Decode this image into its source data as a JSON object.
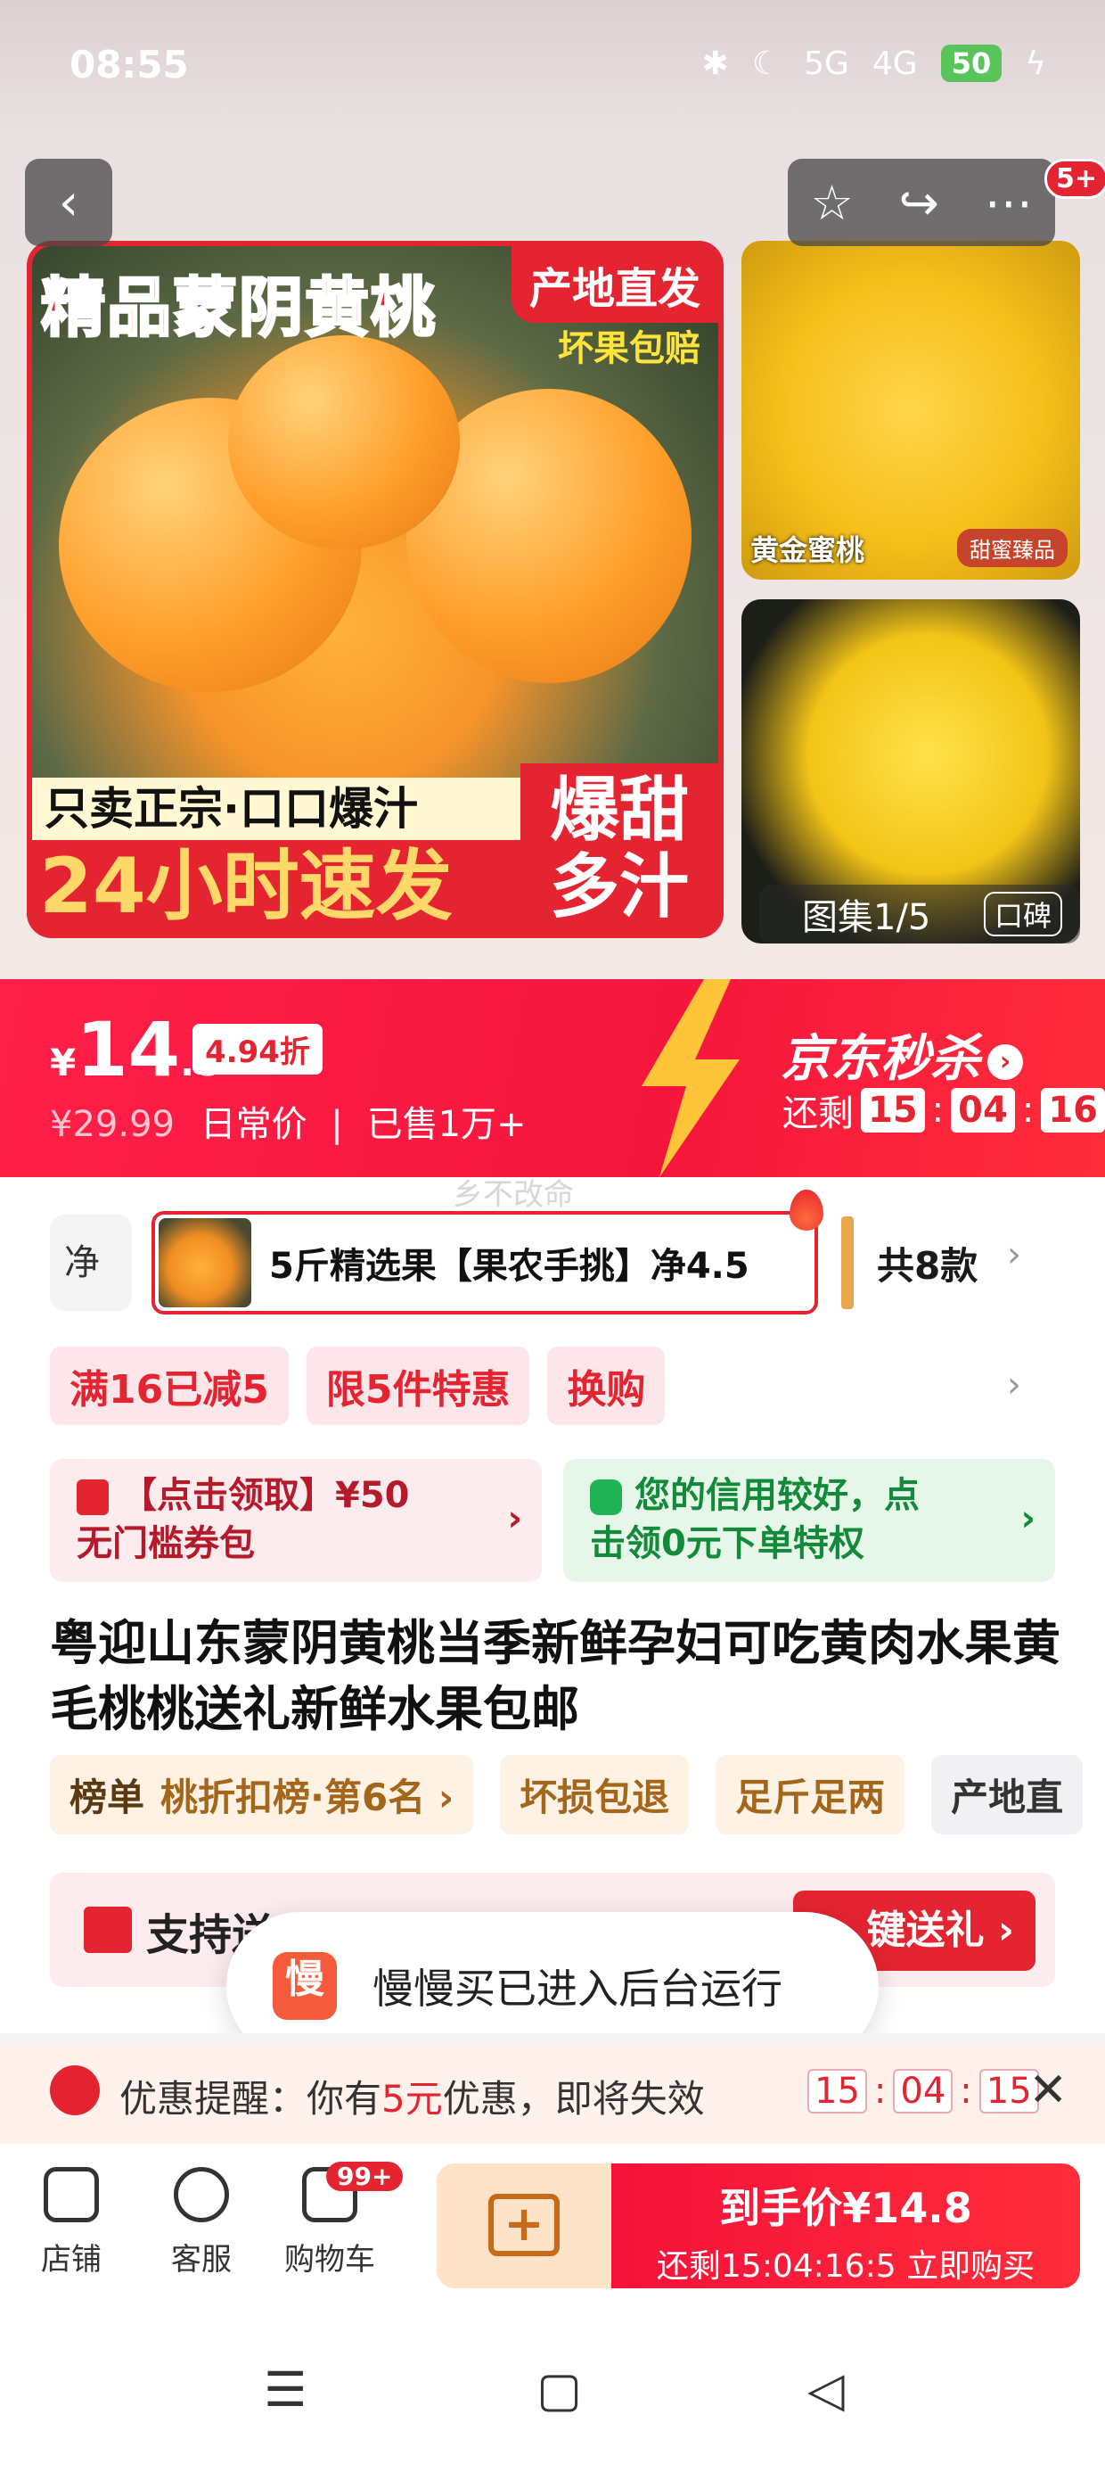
{
  "status_bar": {
    "time": "08:55",
    "battery": "50",
    "signal1": "5G",
    "signal2": "4G"
  },
  "hero": {
    "main_title": "精品蒙阴黄桃",
    "origin_tag": "产地直发",
    "bad_fruit_tag": "坏果包赔",
    "banner_line1": "只卖正宗·口口爆汁",
    "banner_line2": "24小时速发",
    "banner_badge_1": "爆甜",
    "banner_badge_2": "多汁",
    "side_a_caption": "黄金蜜桃",
    "side_a_tag": "甜蜜臻品",
    "gallery_label": "图集1/5",
    "reviews_label": "口碑",
    "more_badge": "5+"
  },
  "price": {
    "currency": "¥",
    "integer": "14",
    "decimal": ".8",
    "discount": "4.94折",
    "original": "¥29.99",
    "daily_label": "日常价",
    "separator": "|",
    "sold": "已售1万+",
    "seckill_label": "京东秒杀",
    "remaining_label": "还剩",
    "cd_h": "15",
    "cd_m": "04",
    "cd_s": "16"
  },
  "watermark": "乡不改命",
  "variants": {
    "prev_label": "净",
    "selected_label": "5斤精选果【果农手挑】净4.5",
    "total": "共8款"
  },
  "promos": [
    "满16已减5",
    "限5件特惠",
    "换购"
  ],
  "coupons": {
    "red_line1": "【点击领取】¥50",
    "red_line2": "无门槛券包",
    "green_line1": "您的信用较好，点",
    "green_line2": "击领0元下单特权"
  },
  "product_title": "粤迎山东蒙阴黄桃当季新鲜孕妇可吃黄肉水果黄毛桃桃送礼新鲜水果包邮",
  "features": {
    "rank_key": "榜单",
    "rank_value": "桃折扣榜·第6名 ›",
    "tag1": "坏损包退",
    "tag2": "足斤足两",
    "tag3": "产地直"
  },
  "gift": {
    "text": "支持送",
    "button": "键送礼 ›"
  },
  "toast": {
    "logo_text": "慢",
    "message": "慢慢买已进入后台运行"
  },
  "reminder": {
    "prefix": "优惠提醒：你有",
    "amount": "5元",
    "suffix": "优惠，即将失效",
    "cd_h": "15",
    "cd_m": "04",
    "cd_s": "15"
  },
  "bottom_bar": {
    "store": "店铺",
    "service": "客服",
    "cart": "购物车",
    "cart_badge": "99+",
    "buy_price": "到手价¥14.8",
    "buy_sub": "还剩15:04:16:5 立即购买"
  },
  "nav": {
    "menu": "☰",
    "home": "▢",
    "back": "◁"
  }
}
